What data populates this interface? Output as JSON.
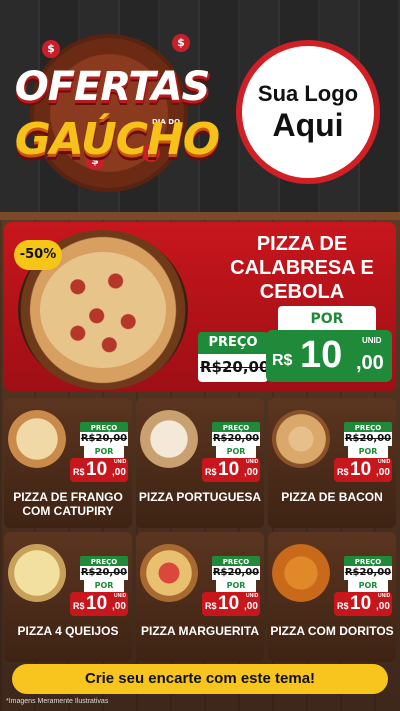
{
  "header": {
    "title_line1": "OFERTAS",
    "title_small": "DIA DO",
    "title_line2": "GAÚCHO",
    "dollar": "$"
  },
  "logo": {
    "line1": "Sua Logo",
    "line2": "Aqui"
  },
  "featured": {
    "discount": "-50%",
    "name": "PIZZA DE CALABRESA E CEBOLA",
    "preco_label": "PREÇO",
    "old_price": "R$20,00",
    "por_label": "POR",
    "currency": "R$",
    "price_int": "10",
    "price_cents": ",00",
    "unit": "UNID"
  },
  "products": [
    {
      "name": "PIZZA DE FRANGO COM CATUPIRY",
      "preco_label": "PREÇO",
      "old_price": "R$20,00",
      "por_label": "POR",
      "currency": "R$",
      "price_int": "10",
      "price_cents": ",00",
      "unit": "UNID"
    },
    {
      "name": "PIZZA PORTUGUESA",
      "preco_label": "PREÇO",
      "old_price": "R$20,00",
      "por_label": "POR",
      "currency": "R$",
      "price_int": "10",
      "price_cents": ",00",
      "unit": "UNID"
    },
    {
      "name": "PIZZA DE BACON",
      "preco_label": "PREÇO",
      "old_price": "R$20,00",
      "por_label": "POR",
      "currency": "R$",
      "price_int": "10",
      "price_cents": ",00",
      "unit": "UNID"
    },
    {
      "name": "PIZZA 4 QUEIJOS",
      "preco_label": "PREÇO",
      "old_price": "R$20,00",
      "por_label": "POR",
      "currency": "R$",
      "price_int": "10",
      "price_cents": ",00",
      "unit": "UNID"
    },
    {
      "name": "PIZZA MARGUERITA",
      "preco_label": "PREÇO",
      "old_price": "R$20,00",
      "por_label": "POR",
      "currency": "R$",
      "price_int": "10",
      "price_cents": ",00",
      "unit": "UNID"
    },
    {
      "name": "PIZZA COM DORITOS",
      "preco_label": "PREÇO",
      "old_price": "R$20,00",
      "por_label": "POR",
      "currency": "R$",
      "price_int": "10",
      "price_cents": ",00",
      "unit": "UNID"
    }
  ],
  "cta": {
    "label": "Crie seu encarte com este tema!"
  },
  "footer": {
    "disclaimer": "*Imagens Meramente Ilustrativas"
  },
  "colors": {
    "brand_red": "#c8161d",
    "price_green": "#1f8a3a",
    "accent_yellow": "#f7c51e"
  }
}
